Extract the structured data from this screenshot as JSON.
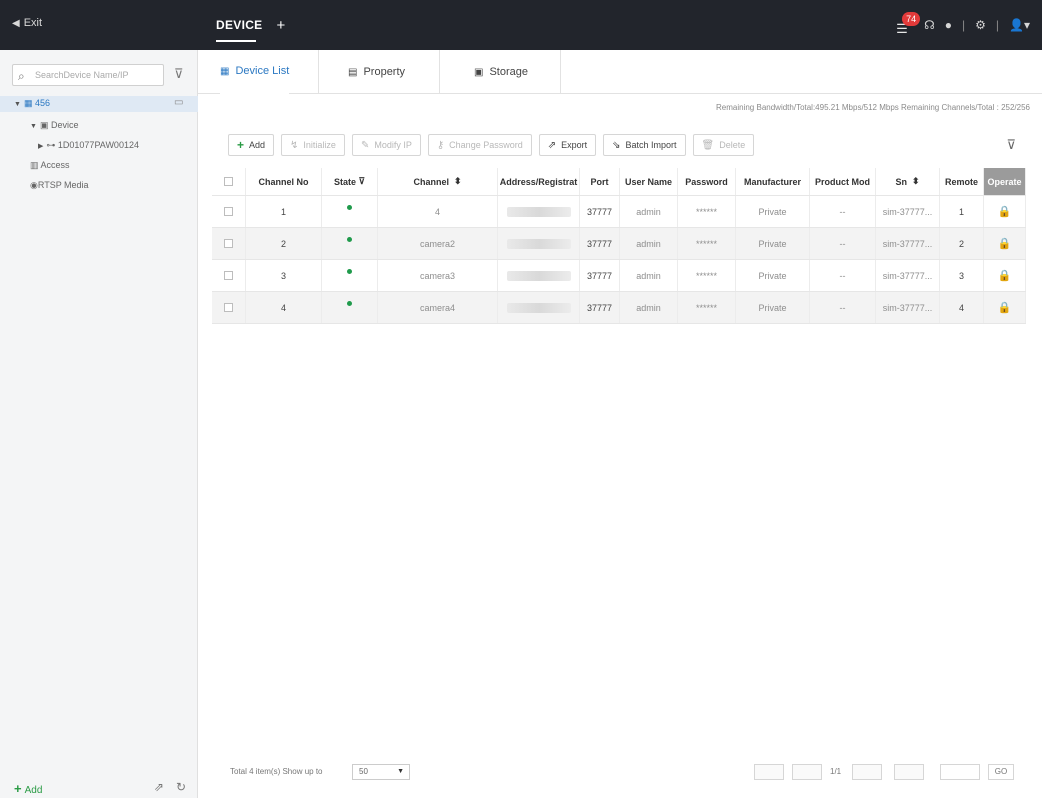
{
  "topbar": {
    "exit_label": "Exit",
    "device_tab": "DEVICE",
    "add_tab": "+",
    "alarm_count": "74"
  },
  "sidebar": {
    "search_placeholder": "SearchDevice Name/IP",
    "root_label": "456",
    "device_label": "Device",
    "device_child": "1D01077PAW00124",
    "access_label": "Access",
    "rtsp_label": "RTSP Media",
    "add_label": "Add"
  },
  "tabs": [
    {
      "label": "Device List",
      "icon": "list-icon"
    },
    {
      "label": "Property",
      "icon": "property-icon"
    },
    {
      "label": "Storage",
      "icon": "storage-icon"
    }
  ],
  "status": {
    "remaining": "Remaining Bandwidth/Total:495.21 Mbps/512 Mbps   Remaining Channels/Total : 252/256"
  },
  "toolbar": {
    "add": "Add",
    "initialize": "Initialize",
    "modify_ip": "Modify IP",
    "change_password": "Change Password",
    "export": "Export",
    "batch_import": "Batch Import",
    "delete": "Delete"
  },
  "table": {
    "headers": [
      "Channel No",
      "State",
      "Channel",
      "Address/Registrat",
      "Port",
      "User Name",
      "Password",
      "Manufacturer",
      "Product Mod",
      "Sn",
      "Remote",
      "Operate"
    ],
    "rows": [
      {
        "no": "1",
        "channel": "4",
        "port": "37777",
        "user": "admin",
        "password": "******",
        "manufacturer": "Private",
        "product": "--",
        "sn": "sim-37777...",
        "remote": "1"
      },
      {
        "no": "2",
        "channel": "camera2",
        "port": "37777",
        "user": "admin",
        "password": "******",
        "manufacturer": "Private",
        "product": "--",
        "sn": "sim-37777...",
        "remote": "2"
      },
      {
        "no": "3",
        "channel": "camera3",
        "port": "37777",
        "user": "admin",
        "password": "******",
        "manufacturer": "Private",
        "product": "--",
        "sn": "sim-37777...",
        "remote": "3"
      },
      {
        "no": "4",
        "channel": "camera4",
        "port": "37777",
        "user": "admin",
        "password": "******",
        "manufacturer": "Private",
        "product": "--",
        "sn": "sim-37777...",
        "remote": "4"
      }
    ]
  },
  "footer": {
    "total": "Total 4 item(s) Show up to",
    "page_size": "50",
    "page_info": "1/1",
    "go": "GO"
  },
  "colors": {
    "topbar": "#22252c",
    "accent": "#2b78c2",
    "online": "#1f9a4b",
    "badge": "#e23a3a"
  }
}
